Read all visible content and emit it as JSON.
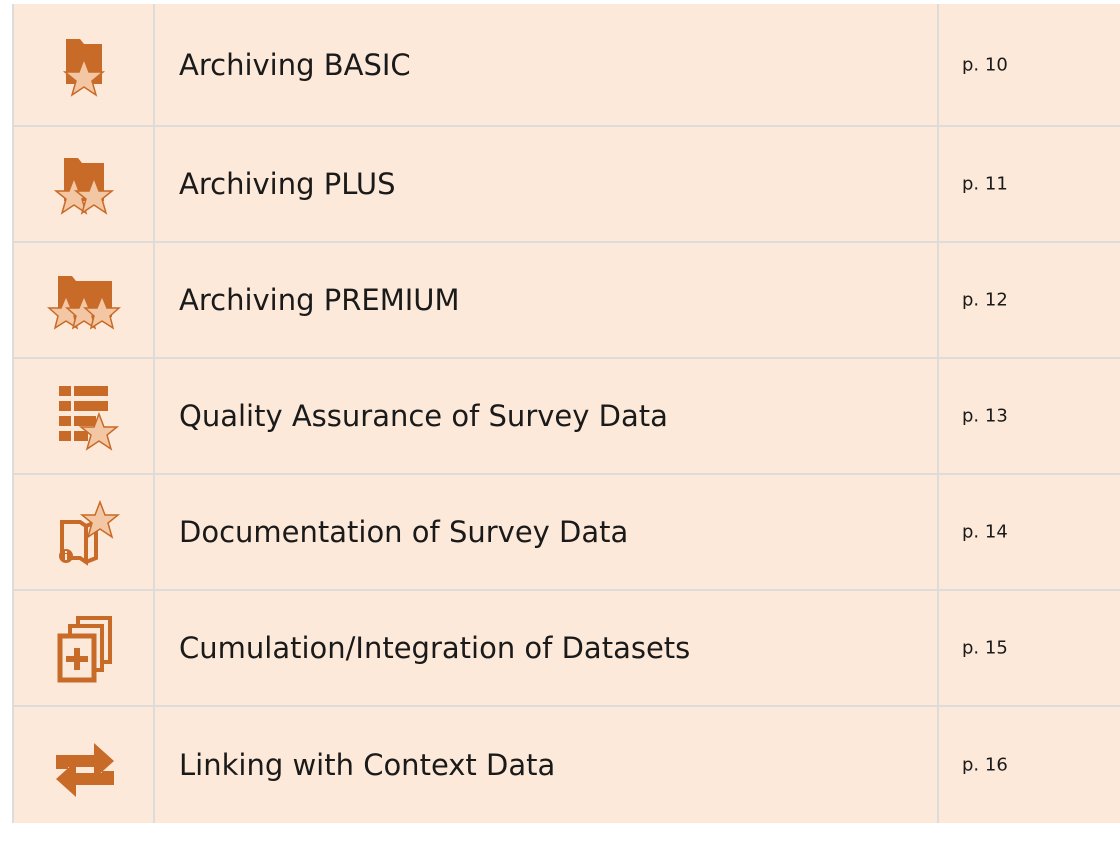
{
  "colors": {
    "background": "#fce9d9",
    "icon": "#c86a28",
    "star_fill": "#f3c7a3",
    "grid": "#dcdcdc"
  },
  "rows": [
    {
      "icon": "folder-star-icon",
      "title": "Archiving BASIC",
      "page": "p. 10"
    },
    {
      "icon": "folder-two-stars-icon",
      "title": "Archiving PLUS",
      "page": "p. 11"
    },
    {
      "icon": "folder-three-stars-icon",
      "title": "Archiving PREMIUM",
      "page": "p. 12"
    },
    {
      "icon": "list-star-icon",
      "title": "Quality Assurance of Survey Data",
      "page": "p. 13"
    },
    {
      "icon": "book-info-star-icon",
      "title": "Documentation of Survey Data",
      "page": "p. 14"
    },
    {
      "icon": "stacked-plus-icon",
      "title": "Cumulation/Integration of Datasets",
      "page": "p. 15"
    },
    {
      "icon": "exchange-arrows-icon",
      "title": "Linking with Context Data",
      "page": "p. 16"
    }
  ]
}
